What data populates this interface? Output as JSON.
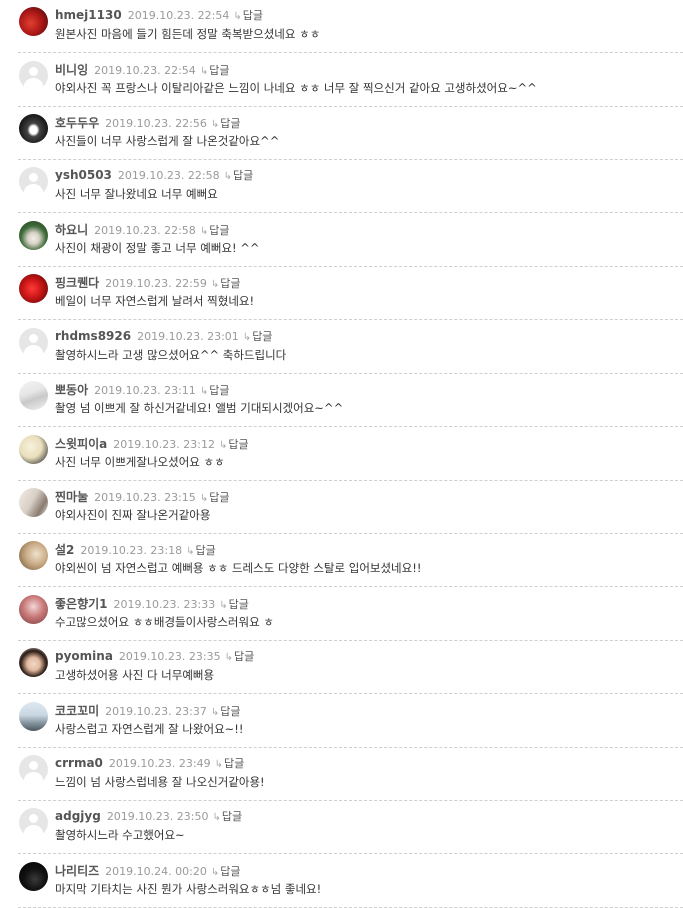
{
  "reply_label": "답글",
  "reply_arrow": "↳",
  "comments": [
    {
      "author": "hmej1130",
      "date": "2019.10.23. 22:54",
      "text": "원본사진 마음에 들기 힘든데 정말 축복받으셨네요 ㅎㅎ",
      "avatar": "photo-red-flowers"
    },
    {
      "author": "비니잉",
      "date": "2019.10.23. 22:54",
      "text": "야외사진 꼭 프랑스나 이탈리아같은 느낌이 나네요 ㅎㅎ 너무 잘 찍으신거 같아요 고생하셨어요~^^",
      "avatar": "default"
    },
    {
      "author": "호두두우",
      "date": "2019.10.23. 22:56",
      "text": "사진들이 너무 사랑스럽게 잘 나온것같아요^^",
      "avatar": "photo-dark-sky"
    },
    {
      "author": "ysh0503",
      "date": "2019.10.23. 22:58",
      "text": "사진 너무 잘나왔네요 너무 예뻐요",
      "avatar": "default"
    },
    {
      "author": "하요니",
      "date": "2019.10.23. 22:58",
      "text": "사진이 채광이 정말 좋고 너무 예뻐요! ^^",
      "avatar": "photo-garden"
    },
    {
      "author": "핑크퀜다",
      "date": "2019.10.23. 22:59",
      "text": "베일이 너무 자연스럽게 날려서 찍혔네요!",
      "avatar": "photo-red-rose"
    },
    {
      "author": "rhdms8926",
      "date": "2019.10.23. 23:01",
      "text": "촬영하시느라 고생 많으셨어요^^ 축하드립니다",
      "avatar": "default"
    },
    {
      "author": "뽀동아",
      "date": "2019.10.23. 23:11",
      "text": "촬영 넘 이쁘게 잘 하신거같네요! 앨범 기대되시겠어요~^^",
      "avatar": "photo-light-figure"
    },
    {
      "author": "스윗피이a",
      "date": "2019.10.23. 23:12",
      "text": "사진 너무 이쁘게잘나오셨어요 ㅎㅎ",
      "avatar": "photo-cream"
    },
    {
      "author": "찐마눌",
      "date": "2019.10.23. 23:15",
      "text": "야외사진이 진짜 잘나온거같아용",
      "avatar": "photo-couple"
    },
    {
      "author": "설2",
      "date": "2019.10.23. 23:18",
      "text": "야외씬이 넘 자연스럽고 예뻐용 ㅎㅎ 드레스도 다양한 스탈로 입어보셨네요!!",
      "avatar": "photo-beige"
    },
    {
      "author": "좋은향기1",
      "date": "2019.10.23. 23:33",
      "text": "수고많으셨어요 ㅎㅎ배경들이사랑스러워요 ㅎ",
      "avatar": "photo-pink-portrait"
    },
    {
      "author": "pyomina",
      "date": "2019.10.23. 23:35",
      "text": "고생하셨어용 사진 다 너무예뻐용",
      "avatar": "photo-woman-dark-hair"
    },
    {
      "author": "코코꼬미",
      "date": "2019.10.23. 23:37",
      "text": "사랑스럽고 자연스럽게 잘 나왔어요~!!",
      "avatar": "photo-eiffel-tower"
    },
    {
      "author": "crrma0",
      "date": "2019.10.23. 23:49",
      "text": "느낌이 넘 사랑스럽네용 잘 나오신거같아용!",
      "avatar": "default"
    },
    {
      "author": "adgjyg",
      "date": "2019.10.23. 23:50",
      "text": "촬영하시느라 수고했어요~",
      "avatar": "default"
    },
    {
      "author": "나리티즈",
      "date": "2019.10.24. 00:20",
      "text": "마지막 기타치는 사진 뭔가 사랑스러워요ㅎㅎ넘 좋네요!",
      "avatar": "photo-night-silhouette"
    }
  ]
}
